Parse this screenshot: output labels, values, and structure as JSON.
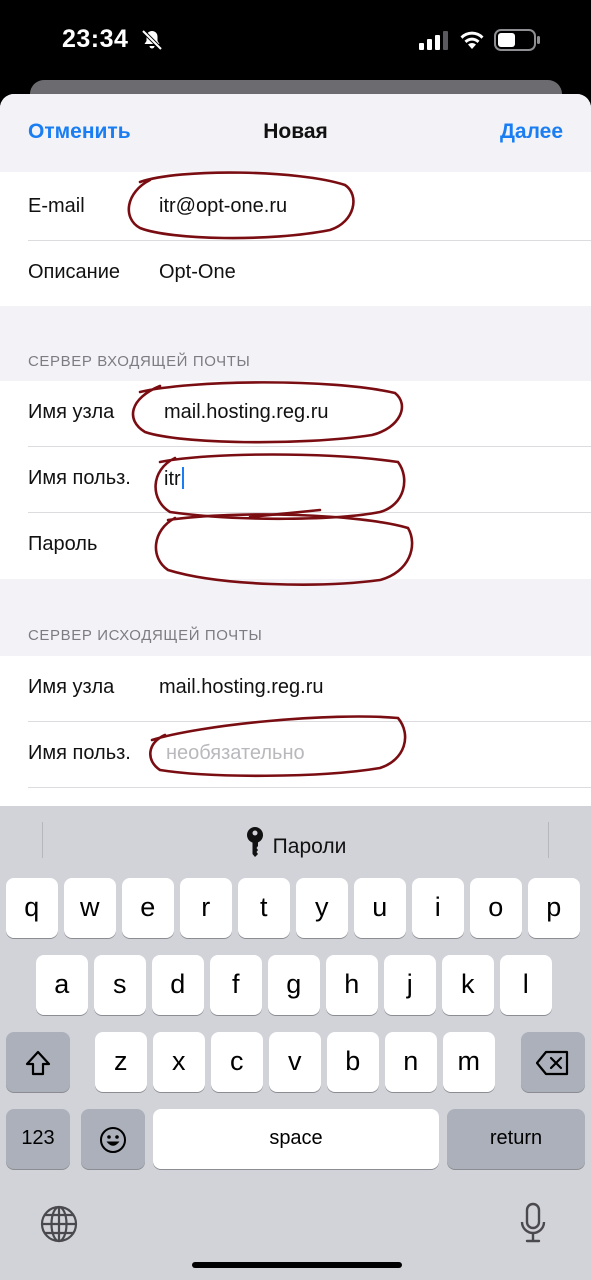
{
  "status_bar": {
    "time": "23:34"
  },
  "nav": {
    "cancel": "Отменить",
    "title": "Новая",
    "next": "Далее"
  },
  "account": {
    "email_label": "E-mail",
    "email_value": "itr@opt-one.ru",
    "description_label": "Описание",
    "description_value": "Opt-One"
  },
  "incoming": {
    "header": "СЕРВЕР ВХОДЯЩЕЙ ПОЧТЫ",
    "host_label": "Имя узла",
    "host_value": "mail.hosting.reg.ru",
    "user_label": "Имя польз.",
    "user_value": "itr",
    "password_label": "Пароль",
    "password_value": ""
  },
  "outgoing": {
    "header": "СЕРВЕР ИСХОДЯЩЕЙ ПОЧТЫ",
    "host_label": "Имя узла",
    "host_value": "mail.hosting.reg.ru",
    "user_label": "Имя польз.",
    "user_placeholder": "необязательно"
  },
  "keyboard": {
    "suggestion": "Пароли",
    "row1": [
      "q",
      "w",
      "e",
      "r",
      "t",
      "y",
      "u",
      "i",
      "o",
      "p"
    ],
    "row2": [
      "a",
      "s",
      "d",
      "f",
      "g",
      "h",
      "j",
      "k",
      "l"
    ],
    "row3": [
      "z",
      "x",
      "c",
      "v",
      "b",
      "n",
      "m"
    ],
    "numbers": "123",
    "space": "space",
    "return": "return"
  },
  "colors": {
    "accent": "#1a7ef2",
    "scribble": "#7a0d12"
  }
}
